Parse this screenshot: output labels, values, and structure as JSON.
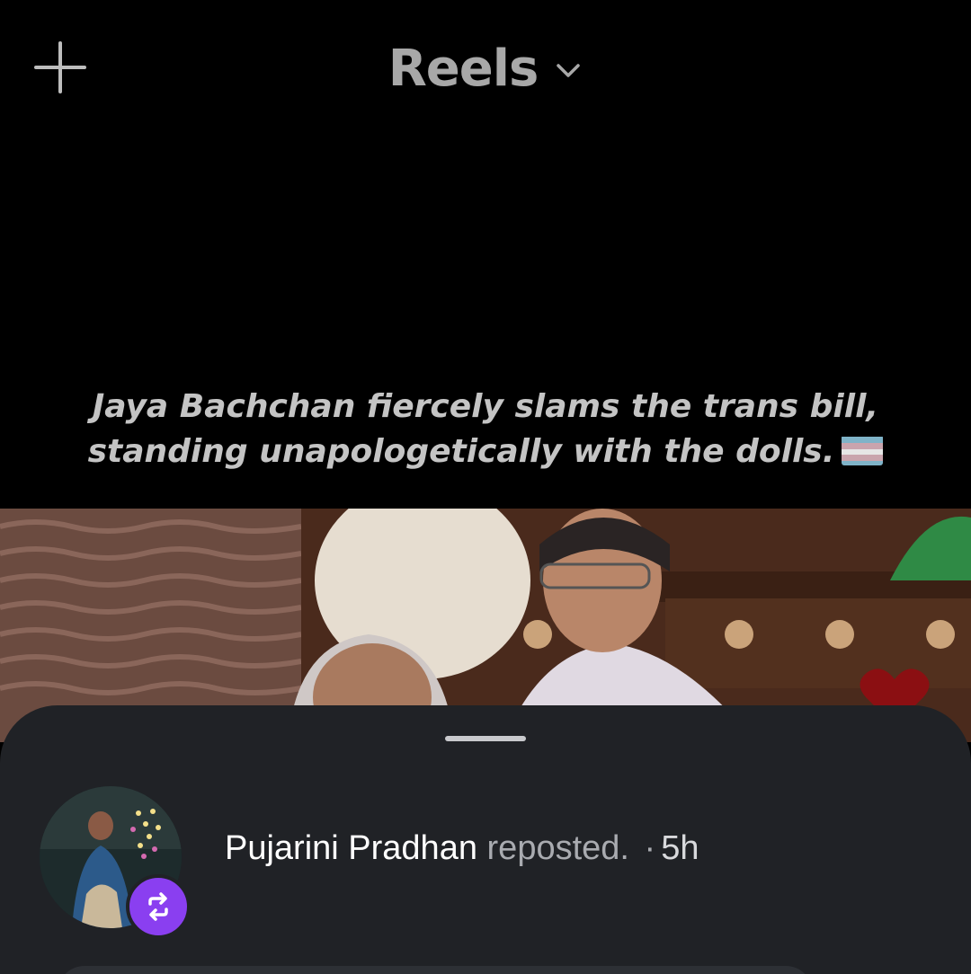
{
  "header": {
    "title": "Reels",
    "create_icon": "plus-icon",
    "dropdown_icon": "chevron-down-icon"
  },
  "reel": {
    "caption_line1": "Jaya Bachchan fiercely slams the trans bill,",
    "caption_line2": "standing unapologetically with the dolls.",
    "caption_emoji": "transgender-flag-icon",
    "liked_icon": "heart-icon",
    "colors": {
      "caption": "#c4c4c4",
      "heart": "#8b0f12"
    }
  },
  "sheet": {
    "author": "Pujarini Pradhan",
    "action": "reposted.",
    "separator": "·",
    "time": "5h",
    "badge_icon": "repost-icon",
    "colors": {
      "background": "#202226",
      "badge": "#8a3ff0"
    }
  }
}
